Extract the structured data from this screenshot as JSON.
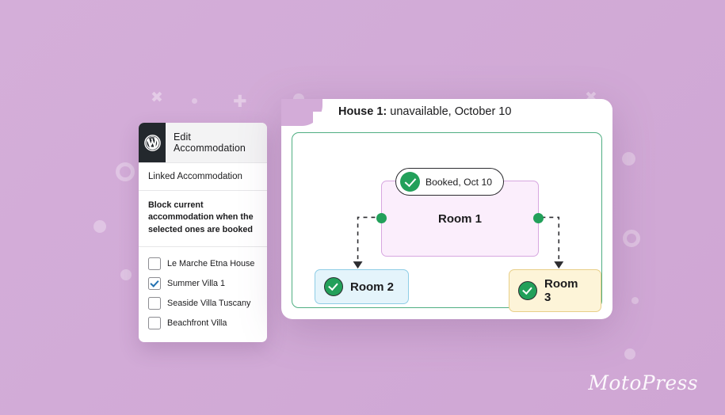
{
  "brand": {
    "wordmark": "MotoPress"
  },
  "sidebar": {
    "logo_icon": "wordpress-icon",
    "header_title": "Edit Accommodation",
    "section_label": "Linked Accommodation",
    "description": "Block current accommodation when the selected ones are booked",
    "items": [
      {
        "label": "Le Marche Etna House",
        "checked": false
      },
      {
        "label": "Summer Villa 1",
        "checked": true
      },
      {
        "label": "Seaside Villa Tuscany",
        "checked": false
      },
      {
        "label": "Beachfront Villa",
        "checked": false
      }
    ]
  },
  "panel": {
    "title_bold": "House 1:",
    "title_rest": " unavailable, October 10",
    "canvas": {
      "badge": {
        "icon": "check-circle-icon",
        "label": "Booked, Oct 10"
      },
      "room1": {
        "label": "Room 1"
      },
      "room2": {
        "icon": "check-circle-icon",
        "label": "Room 2"
      },
      "room3": {
        "icon": "check-circle-icon",
        "label": "Room 3"
      }
    }
  },
  "colors": {
    "background": "#d3acd8",
    "panel": "#ffffff",
    "canvas_border": "#4fae82",
    "room1_fill": "#fbeefc",
    "room1_border": "#d7a7e0",
    "room2_fill": "#e4f4fb",
    "room2_border": "#8fcde6",
    "room3_fill": "#fdf4d8",
    "room3_border": "#e8cf88",
    "check_green": "#22a05a",
    "checkbox_blue": "#2271b1",
    "wp_badge": "#23282d"
  }
}
